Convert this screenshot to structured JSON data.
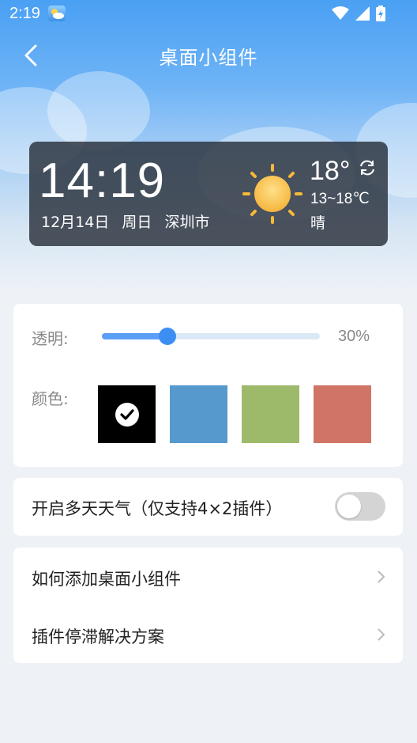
{
  "status_bar": {
    "time": "2:19"
  },
  "nav": {
    "title": "桌面小组件"
  },
  "widget": {
    "time": "14:19",
    "date": "12月14日",
    "weekday": "周日",
    "city": "深圳市",
    "temperature": "18°",
    "range": "13~18℃",
    "condition": "晴"
  },
  "settings": {
    "transparency_label": "透明:",
    "transparency_value": "30%",
    "transparency_level": 0.3,
    "color_label": "颜色:",
    "colors": [
      "#000000",
      "#5699cc",
      "#9dba6b",
      "#d07565"
    ],
    "selected_color_index": 0
  },
  "options": {
    "multiday_label": "开启多天天气（仅支持4×2插件）",
    "multiday_enabled": false
  },
  "help": {
    "items": [
      {
        "label": "如何添加桌面小组件"
      },
      {
        "label": "插件停滞解决方案"
      }
    ]
  },
  "theme": {
    "accent": "#3d8ef2",
    "header": "#4aa0f3"
  }
}
